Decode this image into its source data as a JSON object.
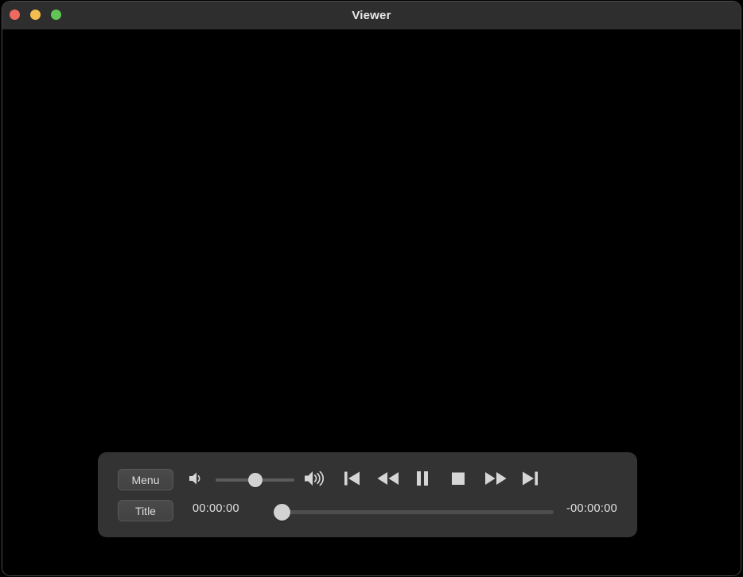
{
  "window": {
    "title": "Viewer",
    "traffic_lights": [
      {
        "name": "close",
        "color": "#ed6a5e"
      },
      {
        "name": "minimize",
        "color": "#f4bd4f"
      },
      {
        "name": "zoom",
        "color": "#61c554"
      }
    ]
  },
  "controls": {
    "menu_label": "Menu",
    "title_label": "Title",
    "volume": {
      "low_icon": "speaker-low-icon",
      "high_icon": "speaker-high-icon",
      "value_percent": 50
    },
    "transport": [
      {
        "name": "previous-chapter",
        "icon": "skip-back-icon"
      },
      {
        "name": "rewind",
        "icon": "rewind-icon"
      },
      {
        "name": "pause",
        "icon": "pause-icon"
      },
      {
        "name": "stop",
        "icon": "stop-icon"
      },
      {
        "name": "fast-forward",
        "icon": "fast-forward-icon"
      },
      {
        "name": "next-chapter",
        "icon": "skip-forward-icon"
      }
    ],
    "timeline": {
      "elapsed": "00:00:00",
      "remaining": "-00:00:00",
      "progress_percent": 0
    }
  },
  "colors": {
    "titlebar": "#2e2e2e",
    "video_background": "#000000",
    "panel": "#333333",
    "button_face": "#474747",
    "icon": "#d6d6d6",
    "text": "#e2e2e2"
  }
}
